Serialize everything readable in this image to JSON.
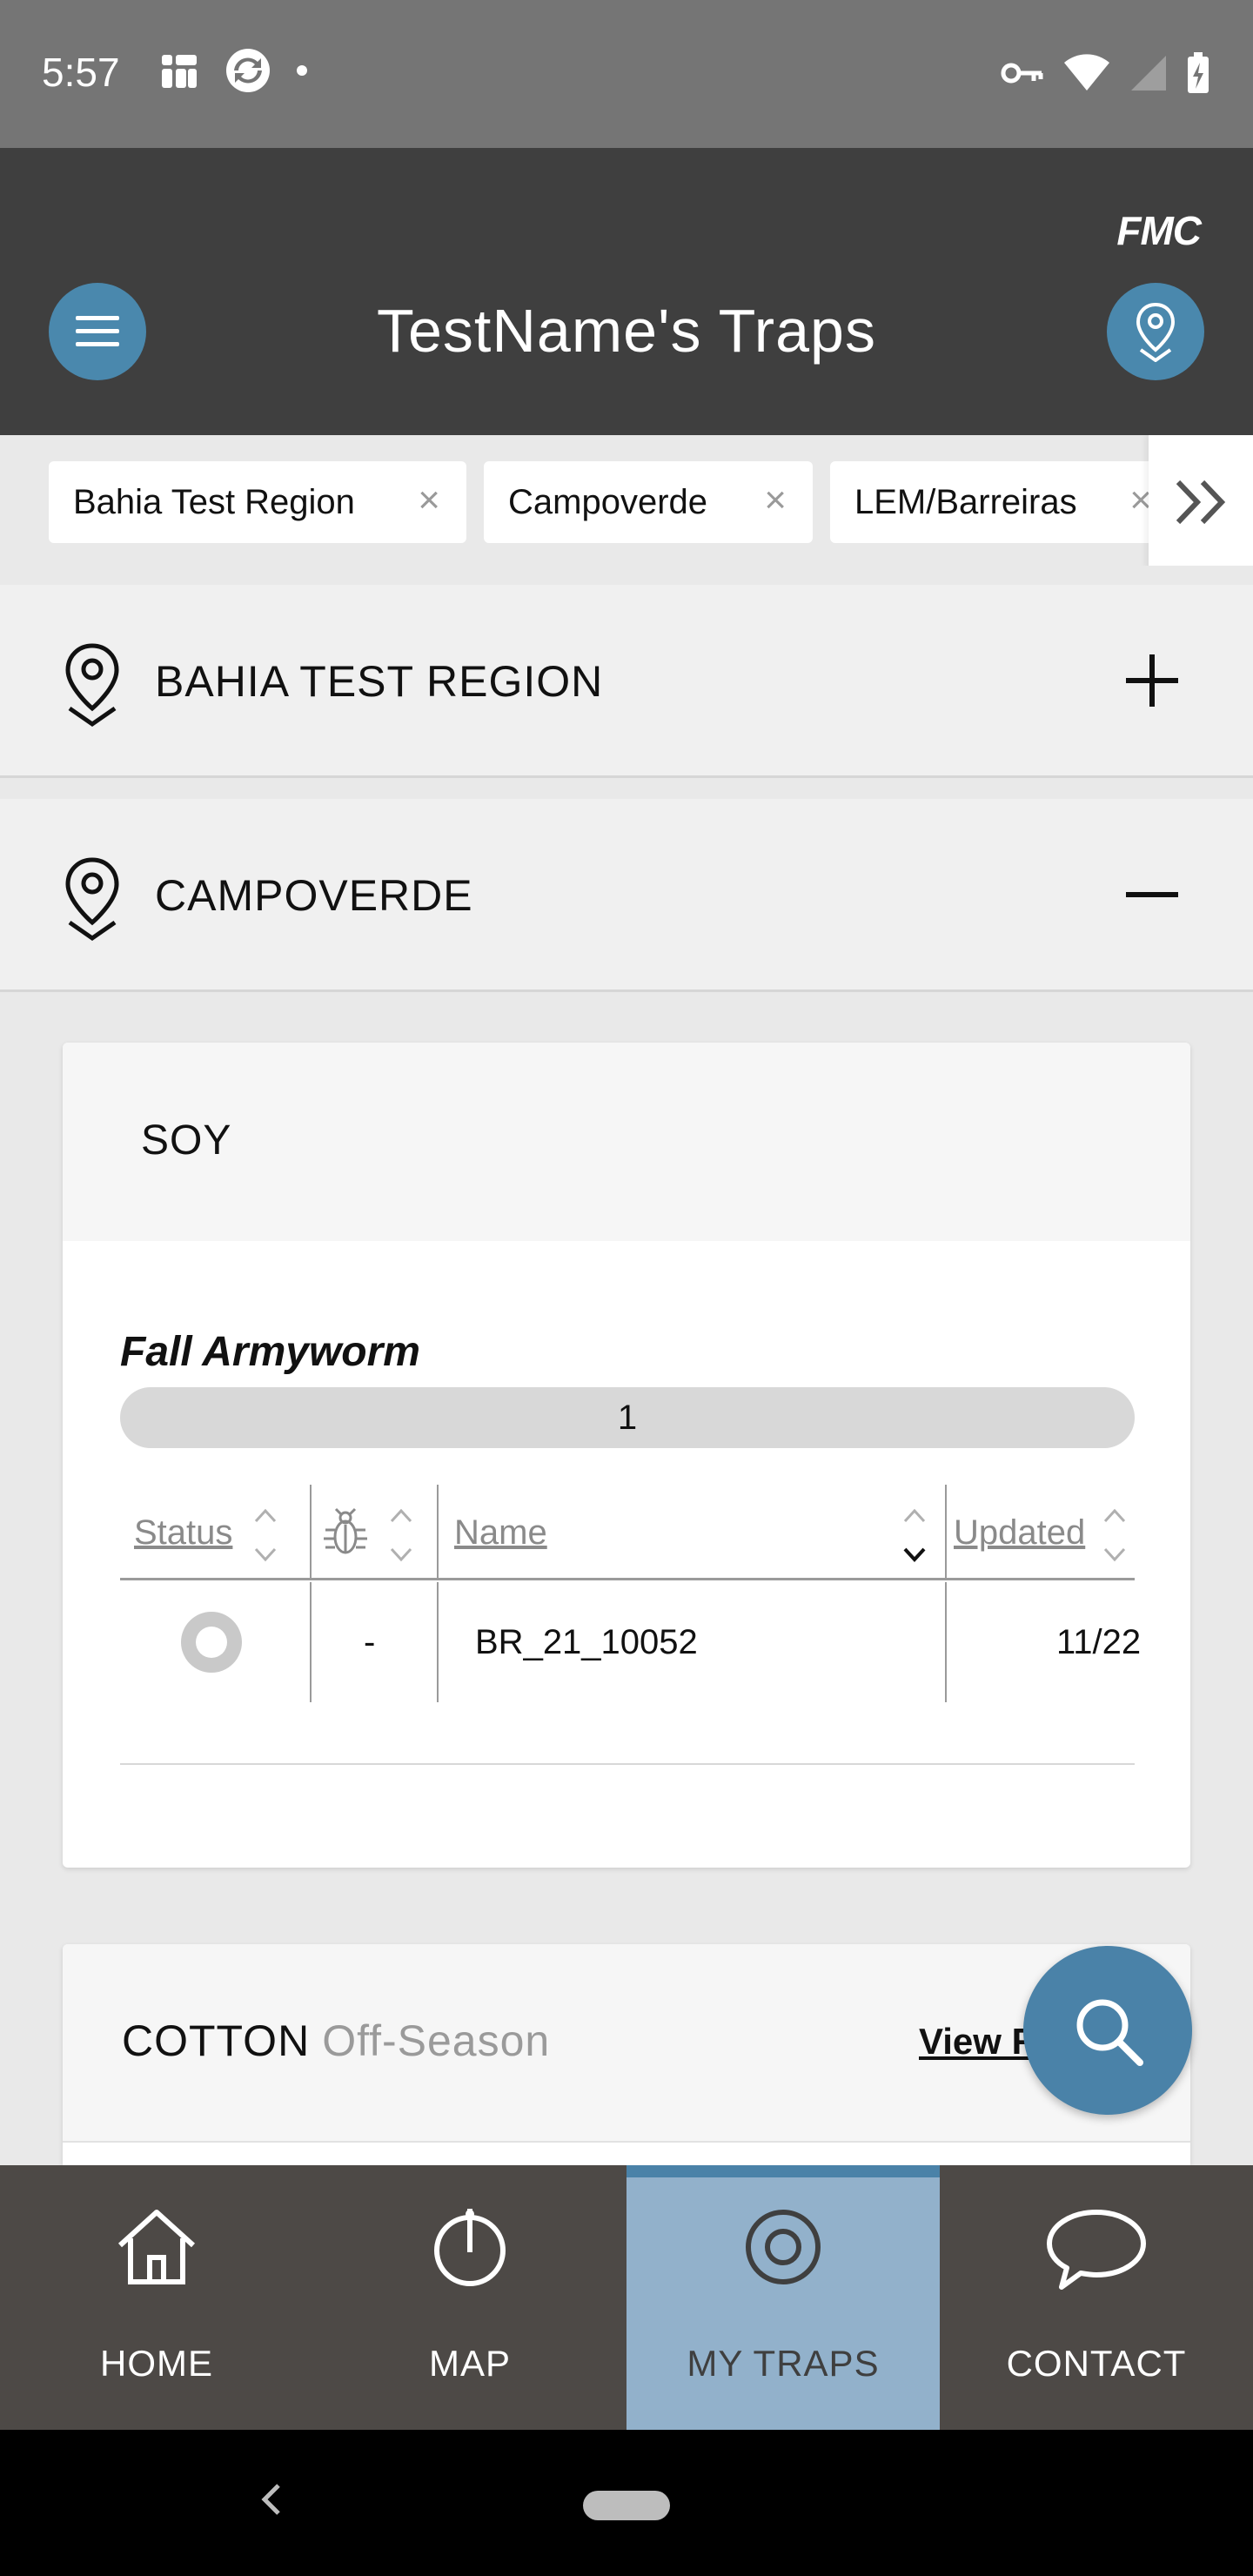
{
  "status_bar": {
    "time": "5:57"
  },
  "header": {
    "brand": "FMC",
    "title": "TestName's Traps"
  },
  "filter_chips": [
    {
      "label": "Bahia Test Region"
    },
    {
      "label": "Campoverde"
    },
    {
      "label": "LEM/Barreiras"
    }
  ],
  "regions": [
    {
      "name": "BAHIA TEST REGION",
      "expanded": false
    },
    {
      "name": "CAMPOVERDE",
      "expanded": true
    }
  ],
  "soy_card": {
    "crop": "SOY",
    "pest": "Fall Armyworm",
    "count_pill": "1",
    "table": {
      "headers": {
        "status": "Status",
        "name": "Name",
        "updated": "Updated"
      },
      "rows": [
        {
          "count": "-",
          "name": "BR_21_10052",
          "updated": "11/22"
        }
      ]
    }
  },
  "cotton_card": {
    "crop": "COTTON",
    "season": "Off-Season",
    "view_link": "View R"
  },
  "bottom_nav": {
    "items": [
      {
        "label": "HOME",
        "icon": "home-icon"
      },
      {
        "label": "MAP",
        "icon": "map-pin-icon"
      },
      {
        "label": "MY TRAPS",
        "icon": "target-icon",
        "active": true
      },
      {
        "label": "CONTACT",
        "icon": "chat-bubble-icon"
      }
    ]
  },
  "colors": {
    "header_bg": "#3f3f3f",
    "accent_blue": "#4a88ad",
    "active_nav_bg": "#92b1cb",
    "nav_bg": "#4d4946"
  }
}
